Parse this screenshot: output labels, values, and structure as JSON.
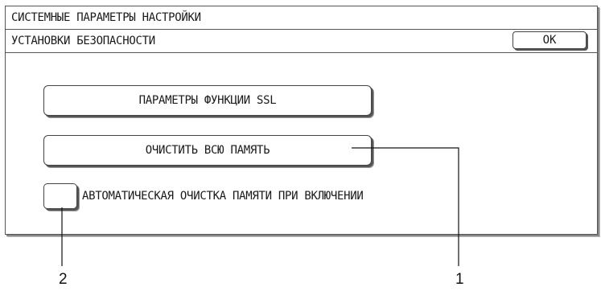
{
  "header": {
    "title": "СИСТЕМНЫЕ ПАРАМЕТРЫ НАСТРОЙКИ",
    "subtitle": "УСТАНОВКИ БЕЗОПАСНОСТИ",
    "ok_label": "OK"
  },
  "main": {
    "ssl_button_label": "ПАРАМЕТРЫ ФУНКЦИИ SSL",
    "clear_memory_button_label": "ОЧИСТИТЬ ВСЮ ПАМЯТЬ",
    "auto_clear_checkbox_label": "АВТОМАТИЧЕСКАЯ ОЧИСТКА ПАМЯТИ ПРИ ВКЛЮЧЕНИИ",
    "auto_clear_checked": false
  },
  "callouts": {
    "one": "1",
    "two": "2"
  }
}
